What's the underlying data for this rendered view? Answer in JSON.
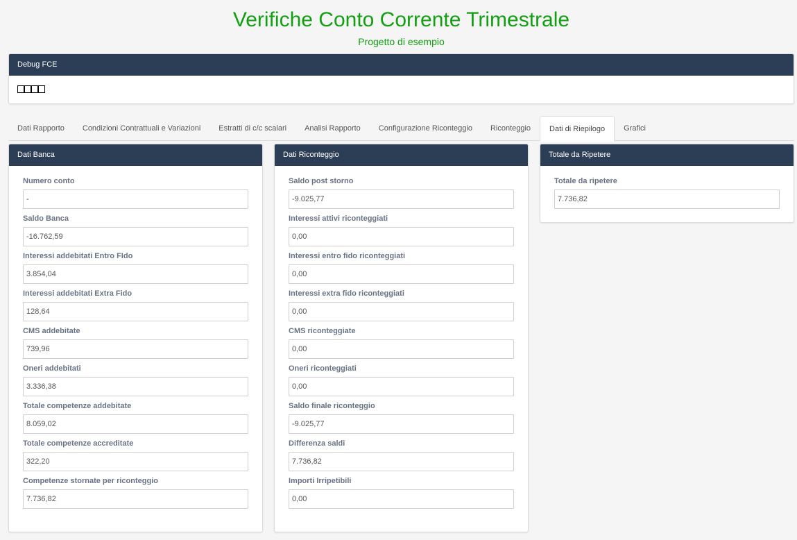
{
  "header": {
    "title": "Verifiche Conto Corrente Trimestrale",
    "subtitle": "Progetto di esempio"
  },
  "debug": {
    "title": "Debug FCE",
    "boxes": [
      "□",
      "□",
      "□",
      "□"
    ]
  },
  "tabs": [
    {
      "label": "Dati Rapporto"
    },
    {
      "label": "Condizioni Contrattuali e Variazioni"
    },
    {
      "label": "Estratti di c/c scalari"
    },
    {
      "label": "Analisi Rapporto"
    },
    {
      "label": "Configurazione Riconteggio"
    },
    {
      "label": "Riconteggio"
    },
    {
      "label": "Dati di Riepilogo",
      "active": true
    },
    {
      "label": "Grafici"
    }
  ],
  "banca": {
    "title": "Dati Banca",
    "fields": [
      {
        "label": "Numero conto",
        "value": "-"
      },
      {
        "label": "Saldo Banca",
        "value": "-16.762,59"
      },
      {
        "label": "Interessi addebitati Entro FIdo",
        "value": "3.854,04"
      },
      {
        "label": "Interessi addebitati Extra Fido",
        "value": "128,64"
      },
      {
        "label": "CMS addebitate",
        "value": "739,96"
      },
      {
        "label": "Oneri addebitati",
        "value": "3.336,38"
      },
      {
        "label": "Totale competenze addebitate",
        "value": "8.059,02"
      },
      {
        "label": "Totale competenze accreditate",
        "value": "322,20"
      },
      {
        "label": "Competenze stornate per riconteggio",
        "value": "7.736,82"
      }
    ]
  },
  "riconteggio": {
    "title": "Dati Riconteggio",
    "fields": [
      {
        "label": "Saldo post storno",
        "value": "-9.025,77"
      },
      {
        "label": "Interessi attivi riconteggiati",
        "value": "0,00"
      },
      {
        "label": "Interessi entro fido riconteggiati",
        "value": "0,00"
      },
      {
        "label": "Interessi extra fido riconteggiati",
        "value": "0,00"
      },
      {
        "label": "CMS riconteggiate",
        "value": "0,00"
      },
      {
        "label": "Oneri riconteggiati",
        "value": "0,00"
      },
      {
        "label": "Saldo finale riconteggio",
        "value": "-9.025,77"
      },
      {
        "label": "Differenza saldi",
        "value": "7.736,82"
      },
      {
        "label": "Importi Irripetibili",
        "value": "0,00"
      }
    ]
  },
  "ripetere": {
    "title": "Totale da Ripetere",
    "fields": [
      {
        "label": "Totale da ripetere",
        "value": "7.736,82"
      }
    ]
  }
}
